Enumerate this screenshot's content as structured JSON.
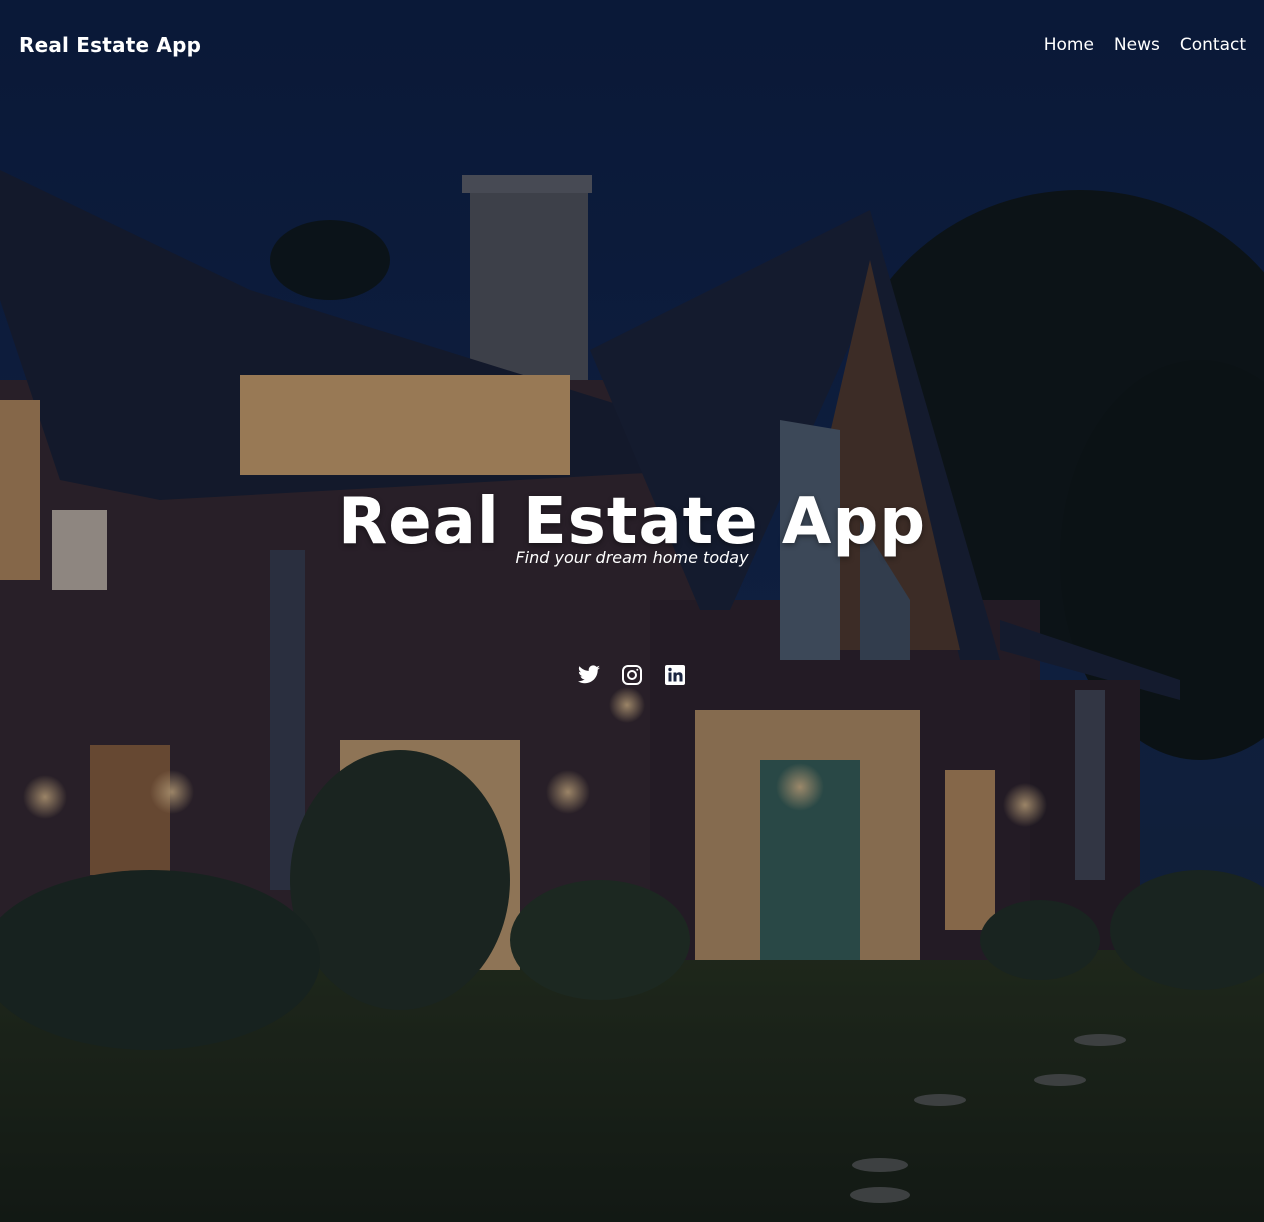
{
  "navbar": {
    "brand": "Real Estate App",
    "links": [
      {
        "label": "Home"
      },
      {
        "label": "News"
      },
      {
        "label": "Contact"
      }
    ]
  },
  "hero": {
    "title": "Real Estate App",
    "subtitle": "Find your dream home today",
    "background": "house-at-dusk-photo"
  },
  "social": [
    {
      "icon": "twitter-icon"
    },
    {
      "icon": "instagram-icon"
    },
    {
      "icon": "linkedin-icon"
    }
  ],
  "colors": {
    "text": "#ffffff",
    "sky": "#0f2750",
    "window_light": "#f2c27a"
  }
}
